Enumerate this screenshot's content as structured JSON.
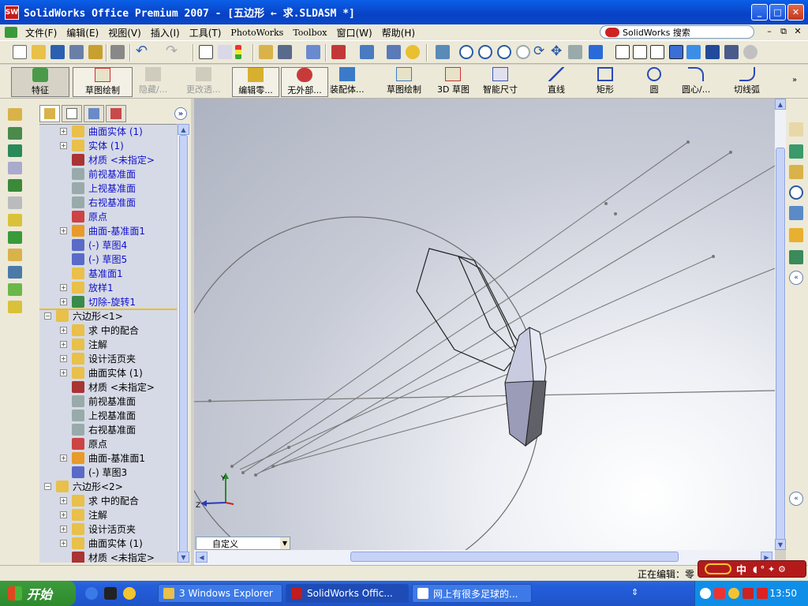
{
  "window": {
    "title": "SolidWorks Office Premium 2007 - [五边形 ← 求.SLDASM *]",
    "app_icon": "SW"
  },
  "menubar": {
    "items": [
      "文件(F)",
      "编辑(E)",
      "视图(V)",
      "插入(I)",
      "工具(T)",
      "PhotoWorks",
      "Toolbox",
      "窗口(W)",
      "帮助(H)"
    ],
    "search_label": "SolidWorks 搜索"
  },
  "command_manager": {
    "feature": "特征",
    "sketch": "草图绘制",
    "hide": "隐藏/...",
    "change_transparency": "更改透...",
    "edit_part": "编辑零...",
    "no_external": "无外部...",
    "assembly": "装配体...",
    "sketch2": "草图绘制",
    "sketch3d": "3D 草图",
    "smart_dim": "智能尺寸",
    "line": "直线",
    "rectangle": "矩形",
    "circle": "圆",
    "center_arc": "圆心/...",
    "tangent_arc": "切线弧"
  },
  "tree": {
    "rows": [
      {
        "label": "曲面实体 (1)",
        "exp": "+",
        "blue": true
      },
      {
        "label": "实体 (1)",
        "exp": "+",
        "blue": true
      },
      {
        "label": "材质 <未指定>",
        "exp": "",
        "blue": true
      },
      {
        "label": "前视基准面",
        "exp": "",
        "blue": true
      },
      {
        "label": "上视基准面",
        "exp": "",
        "blue": true
      },
      {
        "label": "右视基准面",
        "exp": "",
        "blue": true
      },
      {
        "label": "原点",
        "exp": "",
        "blue": true
      },
      {
        "label": "曲面-基准面1",
        "exp": "+",
        "blue": true
      },
      {
        "label": "(-) 草图4",
        "exp": "",
        "blue": true
      },
      {
        "label": "(-) 草图5",
        "exp": "",
        "blue": true
      },
      {
        "label": "基准面1",
        "exp": "",
        "blue": true
      },
      {
        "label": "放样1",
        "exp": "+",
        "blue": true
      },
      {
        "label": "切除-旋转1",
        "exp": "+",
        "blue": true
      },
      {
        "label": "六边形<1>",
        "exp": "-",
        "blue": false
      },
      {
        "label": "求 中的配合",
        "exp": "+",
        "blue": false
      },
      {
        "label": "注解",
        "exp": "+",
        "blue": false
      },
      {
        "label": "设计活页夹",
        "exp": "+",
        "blue": false
      },
      {
        "label": "曲面实体 (1)",
        "exp": "+",
        "blue": false
      },
      {
        "label": "材质 <未指定>",
        "exp": "",
        "blue": false
      },
      {
        "label": "前视基准面",
        "exp": "",
        "blue": false
      },
      {
        "label": "上视基准面",
        "exp": "",
        "blue": false
      },
      {
        "label": "右视基准面",
        "exp": "",
        "blue": false
      },
      {
        "label": "原点",
        "exp": "",
        "blue": false
      },
      {
        "label": "曲面-基准面1",
        "exp": "+",
        "blue": false
      },
      {
        "label": "(-) 草图3",
        "exp": "",
        "blue": false
      },
      {
        "label": "六边形<2>",
        "exp": "-",
        "blue": false
      },
      {
        "label": "求 中的配合",
        "exp": "+",
        "blue": false
      },
      {
        "label": "注解",
        "exp": "+",
        "blue": false
      },
      {
        "label": "设计活页夹",
        "exp": "+",
        "blue": false
      },
      {
        "label": "曲面实体 (1)",
        "exp": "+",
        "blue": false
      },
      {
        "label": "材质 <未指定>",
        "exp": "",
        "blue": false
      }
    ]
  },
  "viewport": {
    "view_selector": "自定义",
    "axis_y": "Y",
    "axis_z": "Z"
  },
  "statusbar": {
    "text": "正在编辑：零"
  },
  "ime": {
    "label": "中"
  },
  "taskbar": {
    "start": "开始",
    "tasks": [
      "3 Windows Explorer",
      "SolidWorks Offic...",
      "网上有很多足球的..."
    ],
    "clock": "13:50"
  },
  "colors": {
    "title_blue": "#0a5fe8",
    "tree_blue_text": "#1010cc",
    "ime_red": "#b31b1b"
  }
}
